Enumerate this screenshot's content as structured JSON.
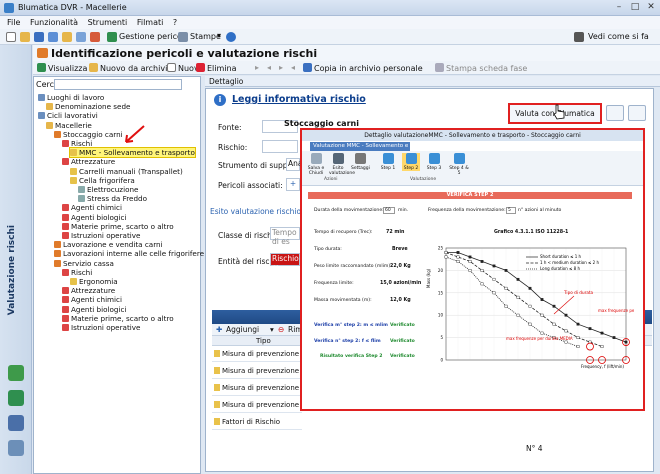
{
  "window": {
    "title": "Blumatica DVR - Macellerie",
    "controls": [
      "–",
      "□",
      "✕"
    ]
  },
  "menu": [
    "File",
    "Funzionalità",
    "Strumenti",
    "Filmati",
    "?"
  ],
  "toolbar1": {
    "gestione": "Gestione pericoli",
    "stampe": "Stampe",
    "vedi": "Vedi come si fa"
  },
  "sidebar": {
    "title": "Valutazione rischi"
  },
  "header": {
    "title": "Identificazione pericoli e valutazione rischi"
  },
  "toolbar2": {
    "visualizza": "Visualizza",
    "nuovo_archivio": "Nuovo da archivio",
    "nuovo": "Nuovo",
    "elimina": "Elimina",
    "copia": "Copia in archivio personale",
    "stampa": "Stampa scheda fase"
  },
  "tree": {
    "search_label": "Cerca",
    "items": [
      {
        "label": "Luoghi di lavoro",
        "level": 0
      },
      {
        "label": "Denominazione sede",
        "level": 1
      },
      {
        "label": "Cicli lavorativi",
        "level": 0
      },
      {
        "label": "Macellerie",
        "level": 1
      },
      {
        "label": "Stoccaggio carni",
        "level": 2
      },
      {
        "label": "Rischi",
        "level": 3
      },
      {
        "label": "MMC - Sollevamento e trasporto",
        "level": 4,
        "selected": true
      },
      {
        "label": "Attrezzature",
        "level": 3
      },
      {
        "label": "Carrelli manuali (Transpallet)",
        "level": 4
      },
      {
        "label": "Cella frigorifera",
        "level": 4
      },
      {
        "label": "Elettrocuzione",
        "level": 5
      },
      {
        "label": "Stress da Freddo",
        "level": 5
      },
      {
        "label": "Agenti chimici",
        "level": 3
      },
      {
        "label": "Agenti biologici",
        "level": 3
      },
      {
        "label": "Materie prime, scarto o altro",
        "level": 3
      },
      {
        "label": "Istruzioni operative",
        "level": 3
      },
      {
        "label": "Lavorazione e vendita carni",
        "level": 2
      },
      {
        "label": "Lavorazioni interne alle celle frigorifere",
        "level": 2
      },
      {
        "label": "Servizio cassa",
        "level": 2
      },
      {
        "label": "Rischi",
        "level": 3
      },
      {
        "label": "Ergonomia",
        "level": 4
      },
      {
        "label": "Attrezzature",
        "level": 3
      },
      {
        "label": "Agenti chimici",
        "level": 3
      },
      {
        "label": "Agenti biologici",
        "level": 3
      },
      {
        "label": "Materie prime, scarto o altro",
        "level": 3
      },
      {
        "label": "Istruzioni operative",
        "level": 3
      }
    ]
  },
  "detail": {
    "tab": "Dettaglio",
    "link": "Leggi informativa rischio",
    "valuta_btn": "Valuta con Blumatica",
    "fonte_label": "Fonte:",
    "rischio_label": "Rischio:",
    "rischio_value": "Stoccaggio carni",
    "strumento_label": "Strumento di supporto:",
    "strumento_value": "Ana",
    "pericoli_label": "Pericoli associati:",
    "esito_section": "Esito valutazione rischio",
    "classe_label": "Classe di rischio",
    "classe_placeholder": "Tempo di es",
    "entita_label": "Entità del rischio",
    "entita_value": "Rischio m",
    "aggiungi": "Aggiungi",
    "rimuovi": "Rimuo",
    "col_tipo": "Tipo",
    "rows": [
      "Misura di prevenzione",
      "Misura di prevenzione",
      "Misura di prevenzione",
      "Misura di prevenzione",
      "Fattori di Rischio"
    ],
    "pager": "N° 4"
  },
  "dialog": {
    "title": "Dettaglio valutazioneMMC - Sollevamento e trasporto - Stoccaggio carni",
    "ribbon_tab": "Valutazione MMC - Sollevamento e trasporto",
    "ribbon_buttons": [
      "Salva e Chiudi",
      "Esito valutazione",
      "Settaggi",
      "Step 1",
      "Step 2",
      "Step 3",
      "Step 4 & 5"
    ],
    "groups": [
      "Azioni",
      "Valutazione"
    ],
    "banner": "VERIFICA STEP 2",
    "durata_label": "Durata della movimentazione:",
    "durata_value": "60",
    "durata_unit": "min.",
    "freq_label": "Frequenza della movimentazione:",
    "freq_value": "5",
    "freq_unit": "n° azioni al minuto",
    "recupero_label": "Tempo di recupero (Trec):",
    "recupero_value": "72 min",
    "grafico": "Grafico 4.3.1.1 ISO 11228-1",
    "tipo_label": "Tipo durata:",
    "tipo_value": "Breve",
    "peso_label": "Peso limite raccomandato (mlim):",
    "peso_value": "22,0 Kg",
    "freqlim_label": "Frequenza limite:",
    "freqlim_value": "15,0 azioni/min",
    "massa_label": "Massa movimentata (m):",
    "massa_value": "12,0 Kg",
    "ver1_label": "Verifica m° step 2: m ≤ mlim",
    "ver1_value": "Verificato",
    "ver2_label": "Verifica n° step 2: f ≤ flim",
    "ver2_value": "Verificato",
    "ris_label": "Risultato verifica Step 2",
    "ris_value": "Verificato",
    "chart": {
      "ylabel": "Mass (kg)",
      "xlabel": "Frequency, f (lift/min)",
      "legend": [
        "Short duration ≤ 1 h",
        "1 h < medium duration ≤ 2 h",
        "Long duration ≤ 8 h"
      ],
      "annot1": "Tipo di durata",
      "annot2": "max frequenze per durata BREVE",
      "annot3": "max frequenze per durata MEDIA"
    }
  },
  "chart_data": {
    "type": "line",
    "xlabel": "Frequency, f (lift/min)",
    "ylabel": "Mass (kg)",
    "x": [
      0,
      1,
      2,
      3,
      4,
      5,
      6,
      7,
      8,
      9,
      10,
      11,
      12,
      13,
      14,
      15
    ],
    "ylim": [
      0,
      25
    ],
    "series": [
      {
        "name": "Short duration ≤ 1 h",
        "values": [
          24,
          24,
          23,
          22,
          21,
          20,
          18,
          16,
          13.5,
          12,
          10,
          8,
          7,
          6,
          5,
          4
        ]
      },
      {
        "name": "1 h < medium duration ≤ 2 h",
        "values": [
          24,
          23,
          22,
          20,
          18,
          16,
          14,
          12,
          10,
          8,
          6.5,
          5,
          4,
          3,
          null,
          null
        ]
      },
      {
        "name": "Long duration ≤ 8 h",
        "values": [
          23,
          22,
          20,
          17,
          15,
          12,
          10,
          8,
          6,
          5,
          4,
          3,
          null,
          null,
          null,
          null
        ]
      }
    ]
  }
}
